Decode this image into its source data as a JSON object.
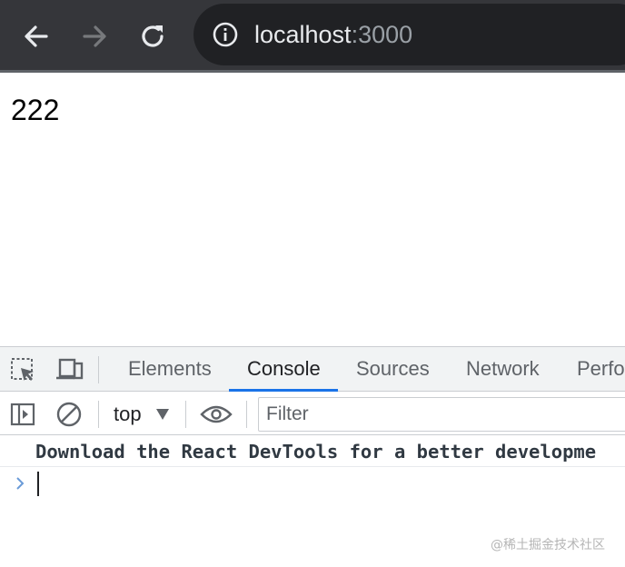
{
  "browser": {
    "address": {
      "host": "localhost",
      "port": ":3000"
    },
    "icons": {
      "back": "arrow-left-icon",
      "forward": "arrow-right-icon",
      "reload": "reload-icon",
      "site_info": "info-icon"
    }
  },
  "page": {
    "text": "222"
  },
  "devtools": {
    "tabs": [
      {
        "label": "Elements"
      },
      {
        "label": "Console",
        "active": true
      },
      {
        "label": "Sources"
      },
      {
        "label": "Network"
      },
      {
        "label": "Perfo"
      }
    ],
    "console": {
      "context": "top",
      "filter_placeholder": "Filter",
      "messages": [
        {
          "text": "Download the React DevTools for a better developme"
        }
      ]
    },
    "colors": {
      "accent": "#1a73e8",
      "toolbar_bg": "#35363a",
      "omnibox_bg": "#202124"
    }
  },
  "watermark": "@稀土掘金技术社区"
}
